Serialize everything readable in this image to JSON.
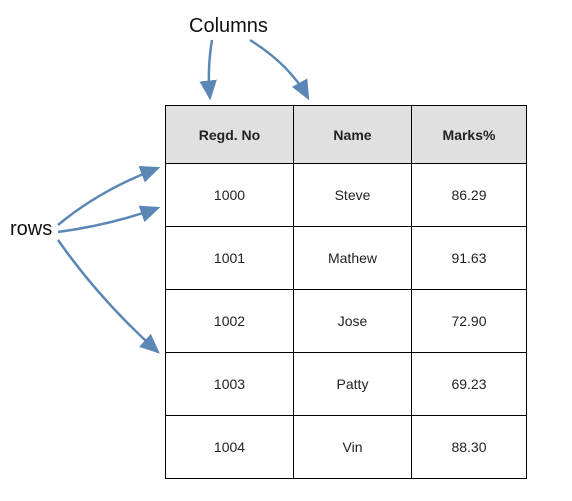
{
  "labels": {
    "columns": "Columns",
    "rows": "rows"
  },
  "chart_data": {
    "type": "table",
    "title": "",
    "columns": [
      "Regd. No",
      "Name",
      "Marks%"
    ],
    "rows": [
      {
        "regd_no": "1000",
        "name": "Steve",
        "marks": "86.29"
      },
      {
        "regd_no": "1001",
        "name": "Mathew",
        "marks": "91.63"
      },
      {
        "regd_no": "1002",
        "name": "Jose",
        "marks": "72.90"
      },
      {
        "regd_no": "1003",
        "name": "Patty",
        "marks": "69.23"
      },
      {
        "regd_no": "1004",
        "name": "Vin",
        "marks": "88.30"
      }
    ]
  },
  "arrow_color": "#5b87b7"
}
